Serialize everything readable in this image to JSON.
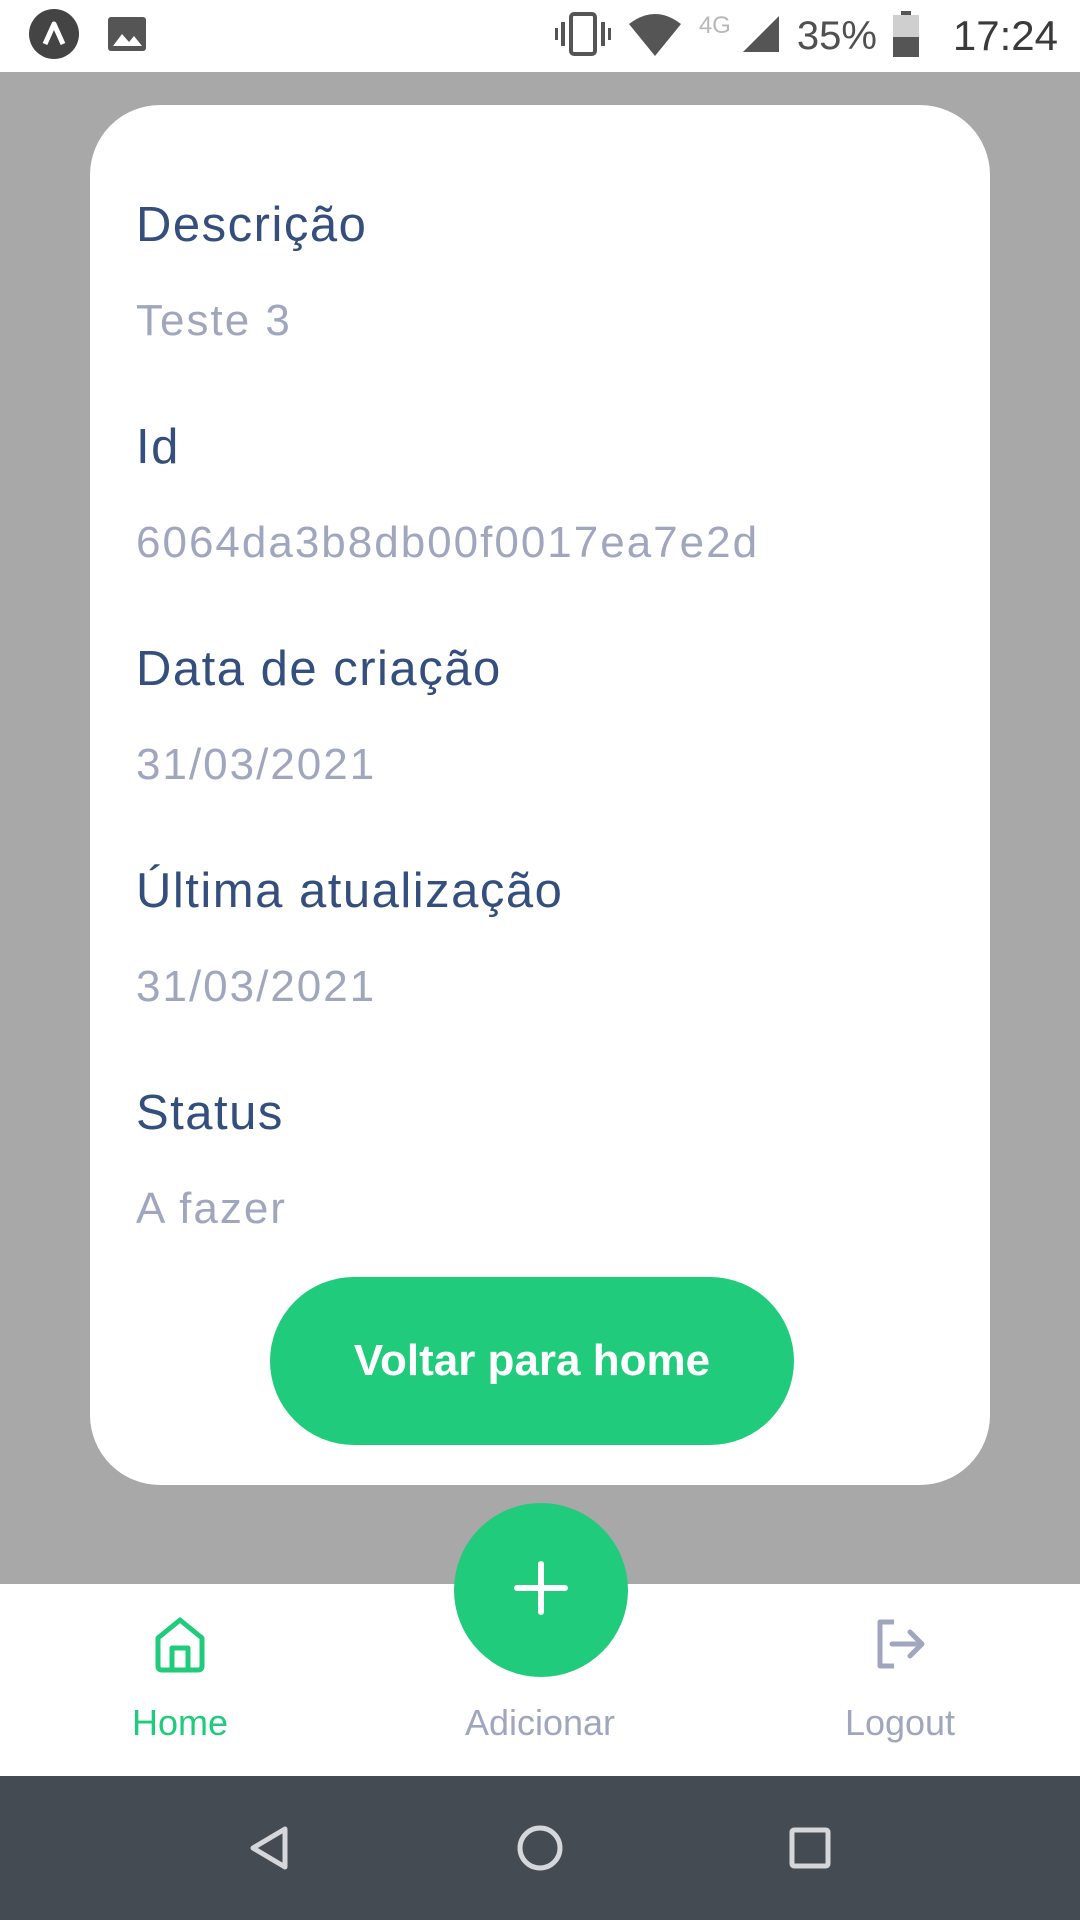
{
  "status_bar": {
    "battery": "35%",
    "time": "17:24",
    "network": "4G",
    "icons": [
      "app-a-icon",
      "image-icon",
      "vibrate-icon",
      "wifi-icon",
      "signal-icon",
      "battery-icon"
    ]
  },
  "task_details": {
    "fields": [
      {
        "label": "Descrição",
        "value": "Teste 3"
      },
      {
        "label": "Id",
        "value": "6064da3b8db00f0017ea7e2d"
      },
      {
        "label": "Data de criação",
        "value": "31/03/2021"
      },
      {
        "label": "Última atualização",
        "value": "31/03/2021"
      },
      {
        "label": "Status",
        "value": "A fazer"
      }
    ],
    "back_button_label": "Voltar para home"
  },
  "tab_bar": {
    "home_label": "Home",
    "add_label": "Adicionar",
    "logout_label": "Logout",
    "active_tab": "Home"
  },
  "colors": {
    "accent": "#20cb7c",
    "label": "#344e7d",
    "value": "#a1a6bf",
    "overlay": "#a8a8a8",
    "nav_bar": "#454b52"
  }
}
